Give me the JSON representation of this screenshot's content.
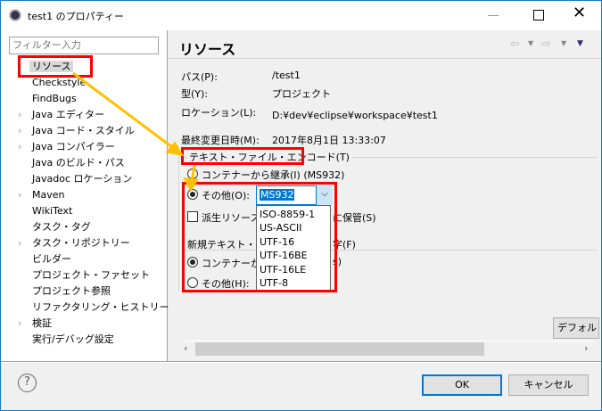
{
  "window": {
    "title": "test1 のプロパティー"
  },
  "filter": {
    "placeholder": "フィルター入力"
  },
  "tree": [
    {
      "label": "リソース",
      "expandable": true,
      "selected": true
    },
    {
      "label": "Checkstyle",
      "expandable": false
    },
    {
      "label": "FindBugs",
      "expandable": false
    },
    {
      "label": "Java エディター",
      "expandable": true
    },
    {
      "label": "Java コード・スタイル",
      "expandable": true
    },
    {
      "label": "Java コンパイラー",
      "expandable": true
    },
    {
      "label": "Java のビルド・パス",
      "expandable": false
    },
    {
      "label": "Javadoc ロケーション",
      "expandable": false
    },
    {
      "label": "Maven",
      "expandable": true
    },
    {
      "label": "WikiText",
      "expandable": false
    },
    {
      "label": "タスク・タグ",
      "expandable": false
    },
    {
      "label": "タスク・リポジトリー",
      "expandable": true
    },
    {
      "label": "ビルダー",
      "expandable": false
    },
    {
      "label": "プロジェクト・ファセット",
      "expandable": false
    },
    {
      "label": "プロジェクト参照",
      "expandable": false
    },
    {
      "label": "リファクタリング・ヒストリー",
      "expandable": false
    },
    {
      "label": "検証",
      "expandable": true
    },
    {
      "label": "実行/デバッグ設定",
      "expandable": false
    }
  ],
  "page": {
    "title": "リソース",
    "path_label": "パス(P):",
    "path_value": "/test1",
    "type_label": "型(Y):",
    "type_value": "プロジェクト",
    "location_label": "ロケーション(L):",
    "location_value": "D:¥dev¥eclipse¥workspace¥test1",
    "modified_label": "最終変更日時(M):",
    "modified_value": "2017年8月1日 13:33:07",
    "encoding_group": "テキスト・ファイル・エンコード(T)",
    "inherit_label": "コンテナーから継承(I) (MS932)",
    "other_label": "その他(O):",
    "encoding_value": "MS932",
    "encoding_options": [
      "ISO-8859-1",
      "US-ASCII",
      "UTF-16",
      "UTF-16BE",
      "UTF-16LE",
      "UTF-8"
    ],
    "derived_label": "派生リソース(",
    "derived_tail": "に保管(S)",
    "newline_group": "新規テキスト・ファ",
    "newline_tail": "字(F)",
    "newline_inherit": "コンテナーから",
    "newline_inherit_tail": "s)",
    "newline_other": "その他(H):",
    "default_button": "デフォルト"
  },
  "footer": {
    "ok": "OK",
    "cancel": "キャンセル"
  },
  "colors": {
    "highlight": "#ff0000",
    "arrow": "#ffc000",
    "accent": "#0078d7"
  }
}
